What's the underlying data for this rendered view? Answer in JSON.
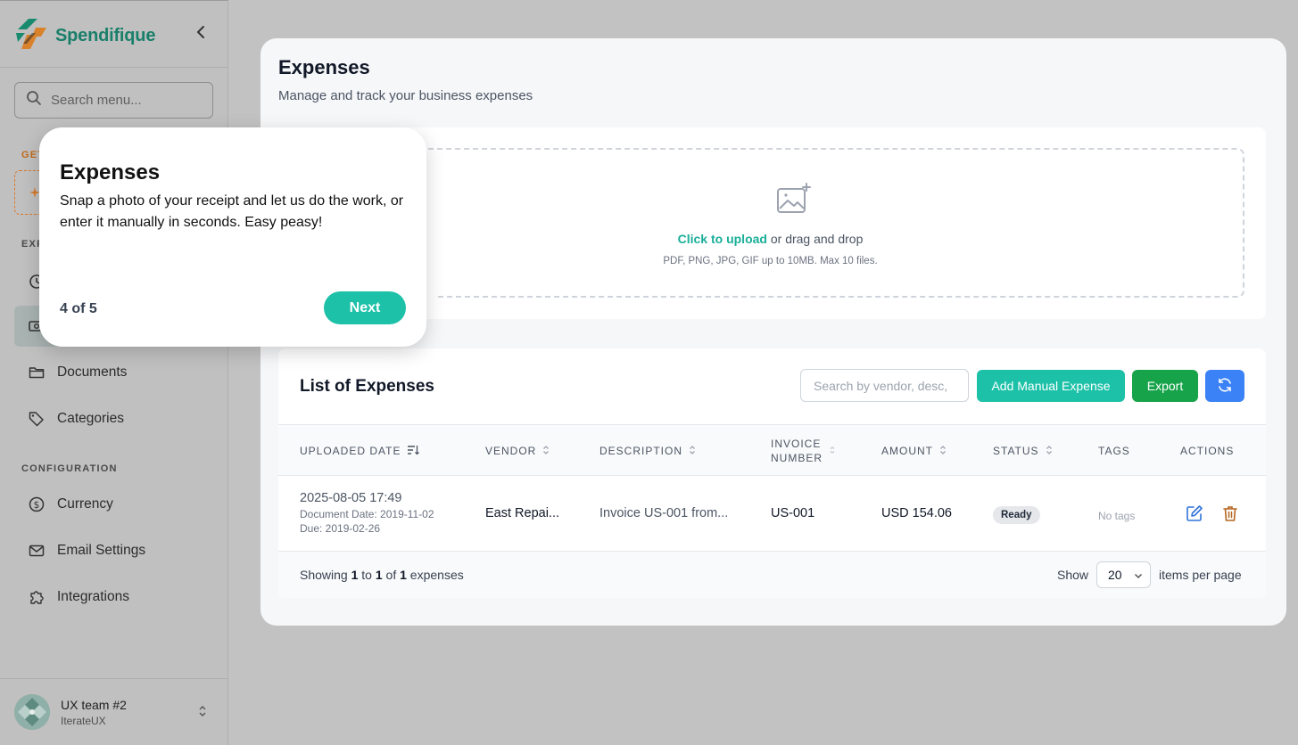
{
  "brand": {
    "name": "Spendifique"
  },
  "sidebar": {
    "search_placeholder": "Search menu...",
    "sections": {
      "getting_started": "GET",
      "expenses": "EXP",
      "configuration": "CONFIGURATION"
    },
    "items": {
      "documents": "Documents",
      "categories": "Categories",
      "currency": "Currency",
      "email_settings": "Email Settings",
      "integrations": "Integrations"
    },
    "user": {
      "name": "UX team #2",
      "org": "IterateUX"
    }
  },
  "page": {
    "title": "Expenses",
    "subtitle": "Manage and track your business expenses"
  },
  "upload": {
    "link": "Click to upload",
    "text": " or drag and drop",
    "hint": "PDF, PNG, JPG, GIF up to 10MB. Max 10 files."
  },
  "list": {
    "title": "List of Expenses",
    "search_placeholder": "Search by vendor, desc,",
    "add_label": "Add Manual Expense",
    "export_label": "Export",
    "columns": {
      "uploaded_date": "UPLOADED DATE",
      "vendor": "VENDOR",
      "description": "DESCRIPTION",
      "invoice_line1": "INVOICE",
      "invoice_line2": "NUMBER",
      "amount": "AMOUNT",
      "status": "STATUS",
      "tags": "TAGS",
      "actions": "ACTIONS"
    },
    "rows": [
      {
        "uploaded": "2025-08-05 17:49",
        "document_date": "Document Date: 2019-11-02",
        "due": "Due: 2019-02-26",
        "vendor": "East Repai...",
        "description": "Invoice US-001 from...",
        "invoice": "US-001",
        "amount": "USD 154.06",
        "status": "Ready",
        "tags": "No tags"
      }
    ],
    "footer": {
      "showing_prefix": "Showing ",
      "from": "1",
      "to_text": " to ",
      "to": "1",
      "of_text": " of ",
      "total": "1",
      "suffix": " expenses",
      "show_label": "Show",
      "per_page": "20",
      "per_page_label": "items per page"
    }
  },
  "tour": {
    "title": "Expenses",
    "body": "Snap a photo of your receipt and let us do the work, or enter it manually in seconds. Easy peasy!",
    "step": "4 of 5",
    "next_label": "Next"
  },
  "colors": {
    "brand_green": "#1a7f6a",
    "accent_teal": "#1cc1a8",
    "export_green": "#17a34a",
    "refresh_blue": "#3b82f6",
    "getting_started_orange": "#d97a2b"
  }
}
